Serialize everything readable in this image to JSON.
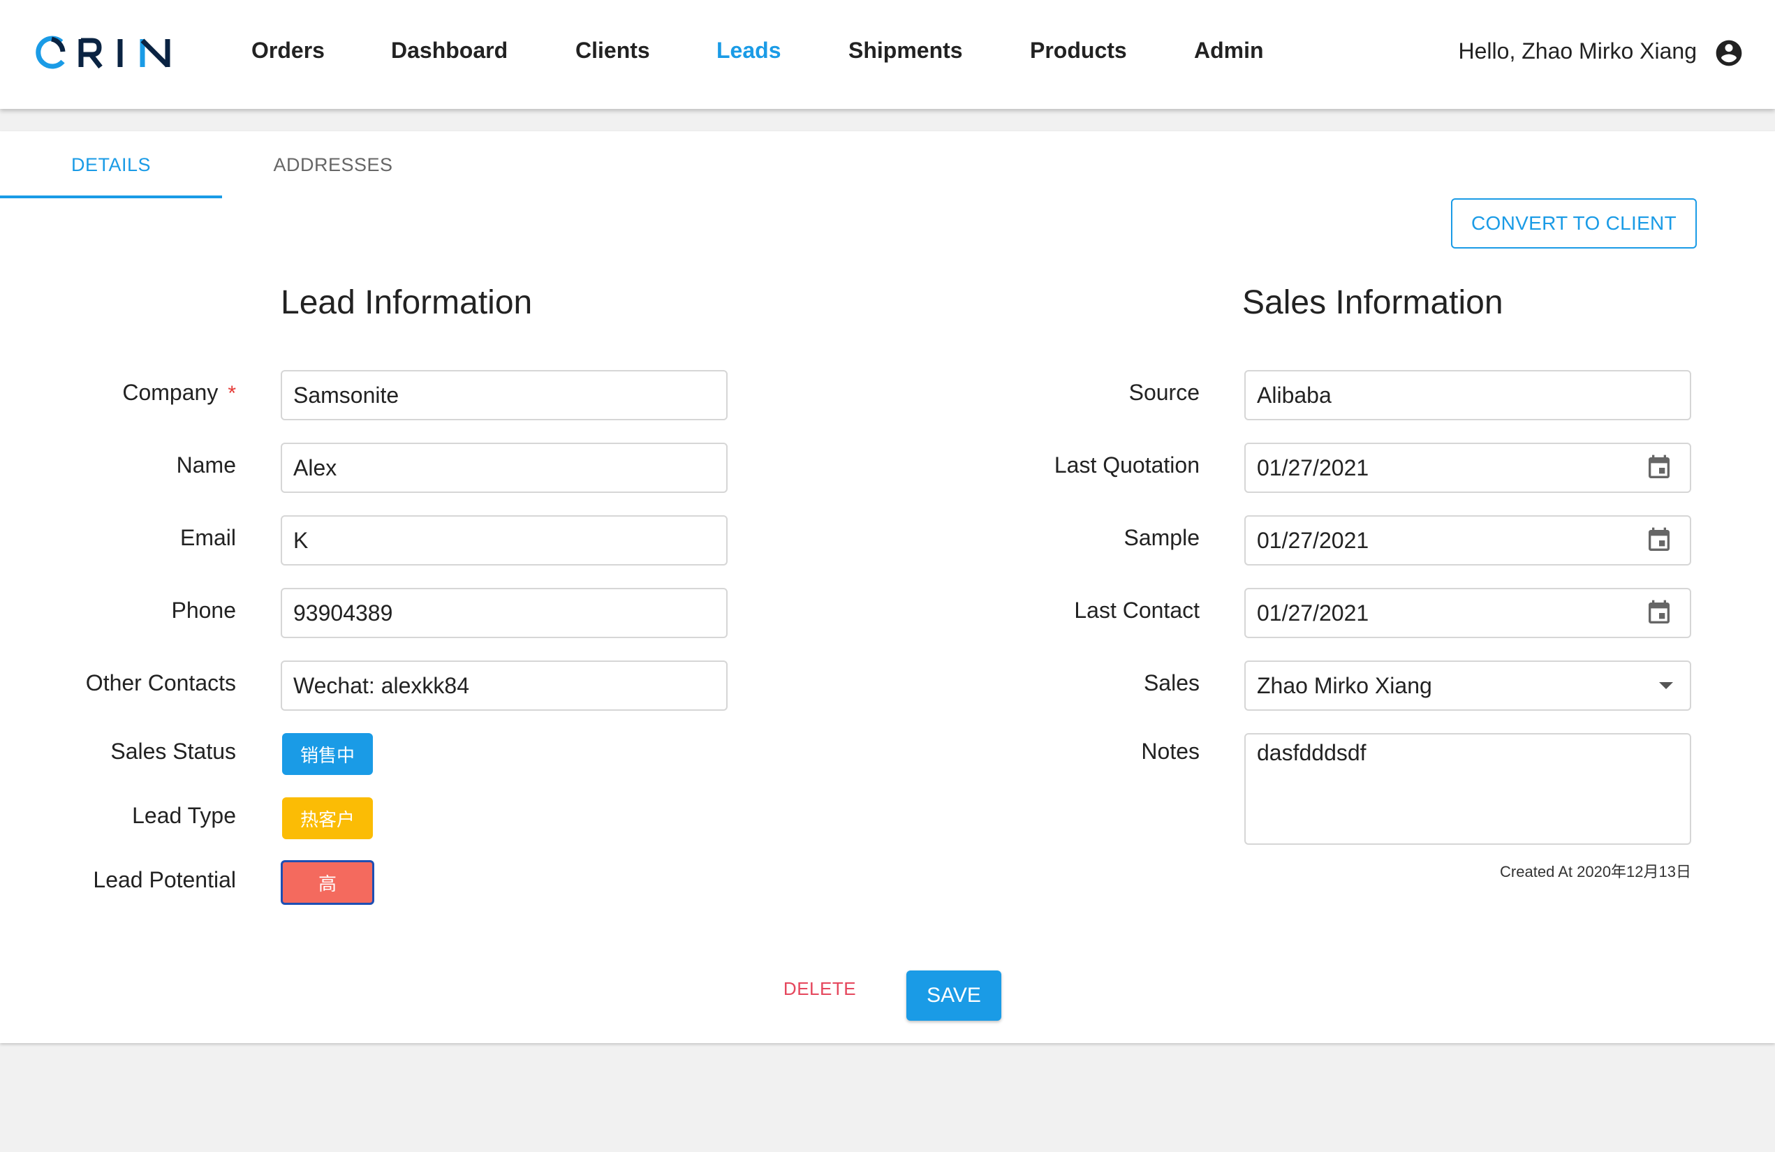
{
  "app": {
    "logo_text": "ORIN"
  },
  "nav": {
    "items": [
      {
        "label": "Orders"
      },
      {
        "label": "Dashboard"
      },
      {
        "label": "Clients"
      },
      {
        "label": "Leads"
      },
      {
        "label": "Shipments"
      },
      {
        "label": "Products"
      },
      {
        "label": "Admin"
      }
    ],
    "active": "Leads",
    "greeting": "Hello, Zhao Mirko Xiang",
    "account_icon": "account-circle-icon"
  },
  "tabs": [
    {
      "label": "DETAILS",
      "active": true
    },
    {
      "label": "ADDRESSES",
      "active": false
    }
  ],
  "actions": {
    "convert_label": "CONVERT TO CLIENT",
    "delete_label": "DELETE",
    "save_label": "SAVE"
  },
  "lead_info": {
    "title": "Lead Information",
    "company": {
      "label": "Company",
      "required_mark": "*",
      "value": "Samsonite"
    },
    "name": {
      "label": "Name",
      "value": "Alex"
    },
    "email": {
      "label": "Email",
      "value": "K"
    },
    "phone": {
      "label": "Phone",
      "value": "93904389"
    },
    "other_contacts": {
      "label": "Other Contacts",
      "value": "Wechat: alexkk84"
    },
    "sales_status": {
      "label": "Sales Status",
      "value": "销售中",
      "color": "#1a9be6"
    },
    "lead_type": {
      "label": "Lead Type",
      "value": "热客户",
      "color": "#fbbc05"
    },
    "lead_potential": {
      "label": "Lead Potential",
      "value": "高",
      "color": "#f46a5e",
      "border_color": "#1e4fb3"
    }
  },
  "sales_info": {
    "title": "Sales Information",
    "source": {
      "label": "Source",
      "value": "Alibaba"
    },
    "last_quotation": {
      "label": "Last Quotation",
      "value": "01/27/2021",
      "icon": "calendar-icon"
    },
    "sample": {
      "label": "Sample",
      "value": "01/27/2021",
      "icon": "calendar-icon"
    },
    "last_contact": {
      "label": "Last Contact",
      "value": "01/27/2021",
      "icon": "calendar-icon"
    },
    "sales": {
      "label": "Sales",
      "value": "Zhao Mirko Xiang"
    },
    "notes": {
      "label": "Notes",
      "value": "dasfdddsdf"
    },
    "created_at": "Created At 2020年12月13日"
  },
  "colors": {
    "accent": "#1a9be6",
    "danger": "#e5475d",
    "background": "#f1f1f1"
  }
}
